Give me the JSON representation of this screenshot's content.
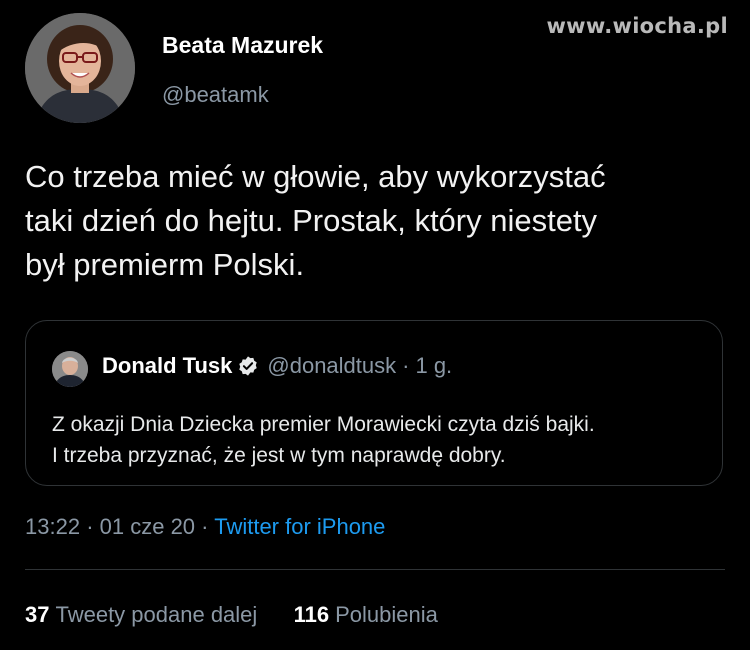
{
  "watermark": "www.wiocha.pl",
  "author": {
    "name": "Beata Mazurek",
    "handle": "@beatamk"
  },
  "tweet": {
    "text": "Co trzeba mieć w głowie, aby wykorzystać\ntaki dzień do hejtu. Prostak, który niestety\nbył premierm Polski."
  },
  "quote": {
    "name": "Donald Tusk",
    "verified_icon": "verified-badge-icon",
    "handle": "@donaldtusk",
    "dot": "·",
    "time": "1 g.",
    "text": "Z okazji Dnia Dziecka premier Morawiecki czyta dziś bajki.\nI trzeba przyznać, że jest w tym naprawdę dobry."
  },
  "meta": {
    "time": "13:22",
    "sep": "·",
    "date": "01 cze 20",
    "sep2": "·",
    "source": "Twitter for iPhone"
  },
  "stats": {
    "retweets_count": "37",
    "retweets_label": "Tweety podane dalej",
    "likes_count": "116",
    "likes_label": "Polubienia"
  },
  "colors": {
    "background": "#000000",
    "accent": "#1d9bf0",
    "secondary_text": "#8b98a5",
    "border": "#2f3336"
  }
}
